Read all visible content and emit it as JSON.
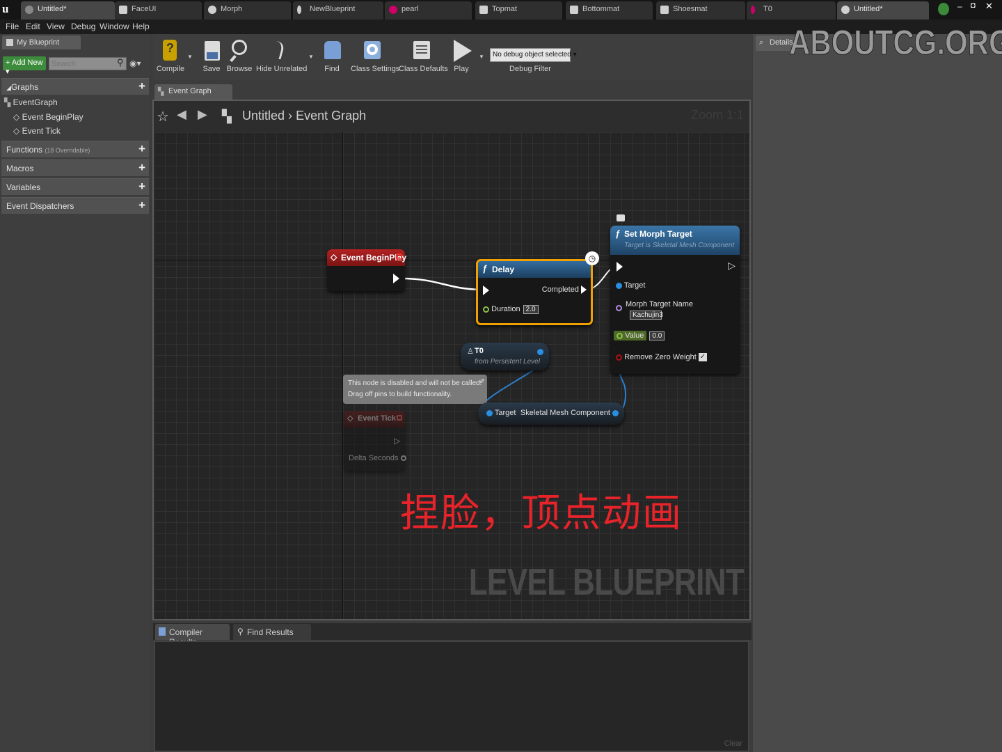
{
  "tabs": [
    "Untitled*",
    "FaceUI",
    "Morph",
    "NewBlueprint",
    "pearl",
    "Topmat",
    "Bottommat",
    "Shoesmat",
    "T0",
    "Untitled*"
  ],
  "menu": [
    "File",
    "Edit",
    "View",
    "Debug",
    "Window",
    "Help"
  ],
  "left": {
    "panel_title": "My Blueprint",
    "add_new": "Add New",
    "search_placeholder": "Search",
    "graphs_label": "Graphs",
    "event_graph": "EventGraph",
    "begin_play": "Event BeginPlay",
    "event_tick": "Event Tick",
    "functions": "Functions",
    "functions_note": "(18 Overridable)",
    "macros": "Macros",
    "variables": "Variables",
    "dispatchers": "Event Dispatchers"
  },
  "toolbar": {
    "compile": "Compile",
    "save": "Save",
    "browse": "Browse",
    "hide_unrelated": "Hide Unrelated",
    "find": "Find",
    "class_settings": "Class Settings",
    "class_defaults": "Class Defaults",
    "play": "Play",
    "debug_select": "No debug object selected",
    "debug_filter": "Debug Filter"
  },
  "graph_tab": "Event Graph",
  "breadcrumb": {
    "root": "Untitled",
    "sep": "›",
    "current": "Event Graph"
  },
  "zoom": "Zoom 1:1",
  "nodes": {
    "begin_play": "Event BeginPlay",
    "delay_title": "Delay",
    "delay_completed": "Completed",
    "delay_duration": "Duration",
    "delay_value": "2.0",
    "t0_title": "T0",
    "t0_sub": "from Persistent Level",
    "disabled_note_1": "This node is disabled and will not be called.",
    "disabled_note_2": "Drag off pins to build functionality.",
    "event_tick": "Event Tick",
    "delta_seconds": "Delta Seconds",
    "target": "Target",
    "skeletal": "Skeletal Mesh Component",
    "smt_title": "Set Morph Target",
    "smt_sub": "Target is Skeletal Mesh Component",
    "smt_target": "Target",
    "smt_morph_name": "Morph Target Name",
    "smt_morph_value": "Kachujin3",
    "smt_value": "Value",
    "smt_value_val": "0.0",
    "smt_remove": "Remove Zero Weight"
  },
  "caption": "捏脸，顶点动画",
  "watermark_graph": "LEVEL BLUEPRINT",
  "watermark_site": "ABOUTCG.ORG",
  "details": "Details",
  "bottom": {
    "compiler": "Compiler Results",
    "find": "Find Results",
    "clear": "Clear"
  },
  "colors": {
    "event_red": "#9a1a1a",
    "function_blue": "#2a5f8f",
    "delay_border": "#f0a000",
    "caption": "#e8232a"
  }
}
